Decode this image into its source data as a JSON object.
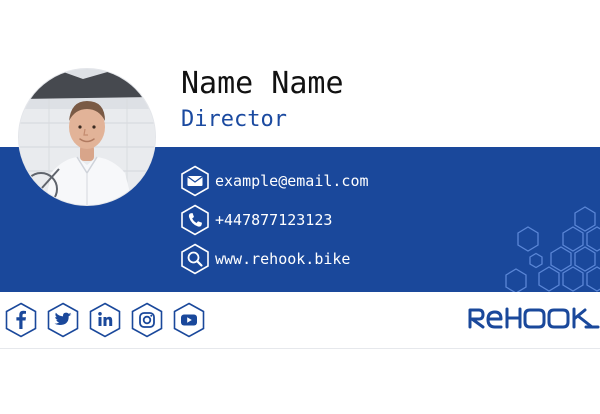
{
  "person": {
    "name": "Name Name",
    "title": "Director"
  },
  "contact": {
    "email": "example@email.com",
    "phone": "+447877123123",
    "website": "www.rehook.bike"
  },
  "social": [
    {
      "network": "facebook",
      "icon": "facebook-icon"
    },
    {
      "network": "twitter",
      "icon": "twitter-icon"
    },
    {
      "network": "linkedin",
      "icon": "linkedin-icon"
    },
    {
      "network": "instagram",
      "icon": "instagram-icon"
    },
    {
      "network": "youtube",
      "icon": "youtube-icon"
    }
  ],
  "brand": {
    "logo_text": "REHOOK"
  },
  "colors": {
    "band": "#1a489b",
    "accent": "#1b4aa0",
    "text_dark": "#111111",
    "icon_white": "#ffffff",
    "hex_light": "#5a86d6"
  }
}
